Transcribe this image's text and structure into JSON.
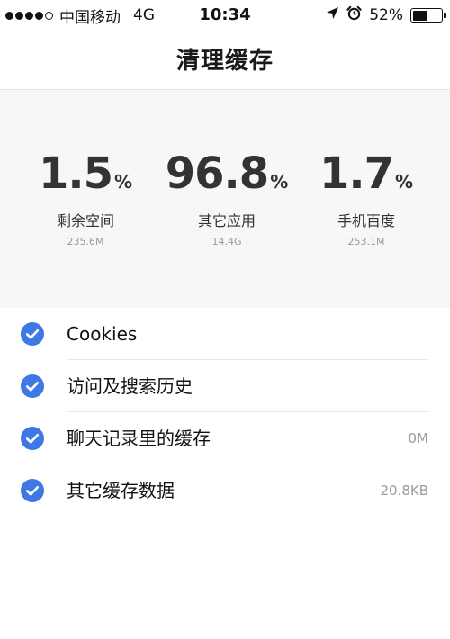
{
  "status_bar": {
    "carrier": "中国移动",
    "network": "4G",
    "time": "10:34",
    "battery_percent": "52%",
    "battery_level": 0.52,
    "signal_strength": 4,
    "signal_max": 5
  },
  "header": {
    "title": "清理缓存"
  },
  "storage": [
    {
      "value": "1.5",
      "unit": "%",
      "label": "剩余空间",
      "size": "235.6M"
    },
    {
      "value": "96.8",
      "unit": "%",
      "label": "其它应用",
      "size": "14.4G"
    },
    {
      "value": "1.7",
      "unit": "%",
      "label": "手机百度",
      "size": "253.1M"
    }
  ],
  "cache_items": [
    {
      "label": "Cookies",
      "size": "",
      "checked": true
    },
    {
      "label": "访问及搜索历史",
      "size": "",
      "checked": true
    },
    {
      "label": "聊天记录里的缓存",
      "size": "0M",
      "checked": true
    },
    {
      "label": "其它缓存数据",
      "size": "20.8KB",
      "checked": true
    }
  ],
  "colors": {
    "accent": "#3e78e4",
    "panel_background": "#f7f7f9",
    "secondary_text": "#9a9a9a"
  }
}
